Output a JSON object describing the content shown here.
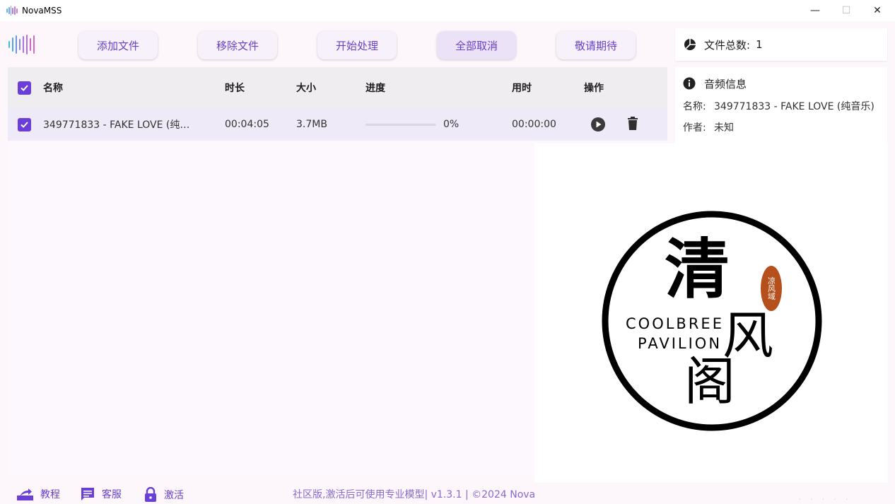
{
  "window": {
    "title": "NovaMSS",
    "minimize": "—",
    "maximize": "☐",
    "close": "✕"
  },
  "toolbar": {
    "buttons": [
      {
        "label": "添加文件"
      },
      {
        "label": "移除文件"
      },
      {
        "label": "开始处理"
      },
      {
        "label": "全部取消"
      },
      {
        "label": "敬请期待"
      }
    ]
  },
  "table": {
    "headers": {
      "name": "名称",
      "duration": "时长",
      "size": "大小",
      "progress": "进度",
      "elapsed": "用时",
      "actions": "操作"
    },
    "rows": [
      {
        "name": "349771833 - FAKE LOVE (纯…",
        "duration": "00:04:05",
        "size": "3.7MB",
        "progress_fraction": 0,
        "progress_text": "0%",
        "elapsed": "00:00:00",
        "checked": true
      }
    ]
  },
  "summary": {
    "label": "文件总数:",
    "count": "1"
  },
  "audio_info": {
    "title": "音频信息",
    "name_label": "名称:",
    "name_value": "349771833 - FAKE LOVE (纯音乐)",
    "author_label": "作者:",
    "author_value": "未知"
  },
  "bottom": {
    "tutorial": "教程",
    "support": "客服",
    "activate": "激活",
    "footer": "社区版,激活后可使用专业模型| v1.3.1 | ©2024 Nova"
  },
  "watermark": {
    "char1": "清",
    "char2": "风",
    "char3": "阁",
    "line1": "COOLBREE",
    "line2": "PAVILION",
    "seal": "凉风域"
  },
  "colors": {
    "accent": "#6b3fd7",
    "accent_text": "#6940c9"
  }
}
